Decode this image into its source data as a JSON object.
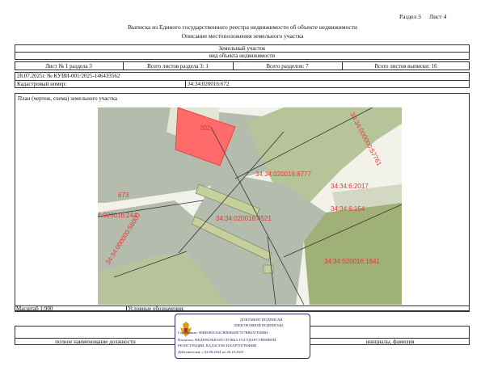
{
  "header": {
    "section": "Раздел 3",
    "sheet": "Лист 4",
    "title": "Выписка из Единого государственного реестра недвижимости об объекте недвижимости",
    "subtitle": "Описание местоположения земельного участка"
  },
  "object": {
    "type": "Земельный участок",
    "type_caption": "вид объекта недвижимости"
  },
  "sheet_row": {
    "sheet_of_section": "Лист № 1 раздела 3",
    "total_sheets_section": "Всего листов раздела 3: 1",
    "total_sections": "Всего разделов: 7",
    "total_sheets_extract": "Всего листов выписки: 16"
  },
  "doc_number": "28.07.2025г. № КУВИ-001/2025-146433562",
  "cadastral": {
    "label": "Кадастровый номер:",
    "value": "34:34:020016:672"
  },
  "plan": {
    "title": "План (чертеж, схема) земельного участка"
  },
  "map_labels": {
    "l202": "202",
    "l673": "673",
    "l8777": "34:34:020016:8777",
    "l244": "34:34:020016:244",
    "l4521": "34:34:020016:4521",
    "l2017": "34:34:6:2017",
    "l154": "34:34:6:154",
    "l1641": "34:34:020016:1641",
    "l57761": "34:34:000000:57761",
    "l56000": "34:34:000000:56000"
  },
  "footer": {
    "scale": "Масштаб 1:900",
    "legend": "Условные обозначения:",
    "position_caption": "полное наименование должности",
    "initials_caption": "инициалы, фамилия"
  },
  "stamp": {
    "line1": "ДОКУМЕНТ ПОДПИСАН",
    "line2": "ЭЛЕКТРОННОЙ ПОДПИСЬЮ",
    "cert": "Сертификат: 00ВЕ6В5С0АСВ0ЕВ02В7557ВВ6А7D2ВВ4",
    "owner1": "Владелец: ФЕДЕРАЛЬНАЯ СЛУЖБА ГОСУДАРСТВЕННОЙ",
    "owner2": "РЕГИСТРАЦИИ, КАДАСТРА И КАРТОГРАФИИ",
    "valid": "Действителен: с 02.08.2024 по 26.10.2025"
  },
  "colors": {
    "green_light": "#b7c49a",
    "green_dark": "#9fb176",
    "grey_area": "#b4bcae",
    "road": "#f2f2ea",
    "pink_target": "#ff6b6b",
    "label_red": "#e53935",
    "stamp_blue": "#2c2f6e"
  }
}
